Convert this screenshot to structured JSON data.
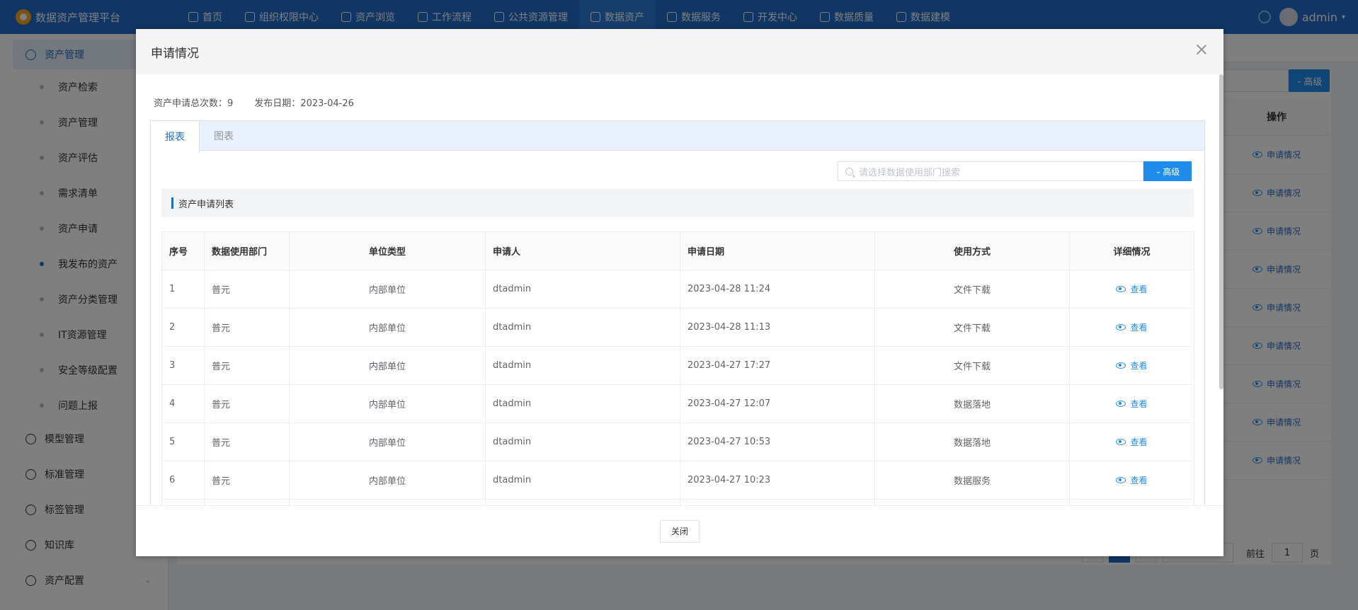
{
  "app": {
    "title": "数据资产管理平台"
  },
  "topnav": {
    "items": [
      {
        "label": "首页"
      },
      {
        "label": "组织权限中心"
      },
      {
        "label": "资产浏览"
      },
      {
        "label": "工作流程"
      },
      {
        "label": "公共资源管理"
      },
      {
        "label": "数据资产"
      },
      {
        "label": "数据服务"
      },
      {
        "label": "开发中心"
      },
      {
        "label": "数据质量"
      },
      {
        "label": "数据建模"
      }
    ],
    "active_index": 5,
    "user": "admin"
  },
  "sidebar": {
    "group_asset": "资产管理",
    "sub_items": [
      {
        "label": "资产检索"
      },
      {
        "label": "资产管理"
      },
      {
        "label": "资产评估"
      },
      {
        "label": "需求清单"
      },
      {
        "label": "资产申请"
      },
      {
        "label": "我发布的资产"
      },
      {
        "label": "资产分类管理"
      },
      {
        "label": "IT资源管理"
      },
      {
        "label": "安全等级配置"
      },
      {
        "label": "问题上报"
      }
    ],
    "active_sub": 5,
    "groups": [
      {
        "label": "模型管理"
      },
      {
        "label": "标准管理"
      },
      {
        "label": "标签管理"
      },
      {
        "label": "知识库"
      },
      {
        "label": "资产配置"
      }
    ]
  },
  "background": {
    "adv_label": "高级",
    "op_header": "操作",
    "op_link": "申请情况",
    "pager": {
      "goto_label": "前往",
      "page_value": "1",
      "page_suffix": "页"
    }
  },
  "dialog": {
    "title": "申请情况",
    "summary": {
      "total_label": "资产申请总次数：",
      "total_value": "9",
      "date_label": "发布日期：",
      "date_value": "2023-04-26"
    },
    "tabs": [
      {
        "label": "报表"
      },
      {
        "label": "图表"
      }
    ],
    "search_placeholder": "请选择数据使用部门搜索",
    "adv_label": "高级",
    "section_title": "资产申请列表",
    "columns": [
      "序号",
      "数据使用部门",
      "单位类型",
      "申请人",
      "申请日期",
      "使用方式",
      "详细情况"
    ],
    "rows": [
      {
        "no": "1",
        "dept": "普元",
        "unit": "内部单位",
        "applicant": "dtadmin",
        "date": "2023-04-28 11:24",
        "usage": "文件下载",
        "detail": "查看"
      },
      {
        "no": "2",
        "dept": "普元",
        "unit": "内部单位",
        "applicant": "dtadmin",
        "date": "2023-04-28 11:13",
        "usage": "文件下载",
        "detail": "查看"
      },
      {
        "no": "3",
        "dept": "普元",
        "unit": "内部单位",
        "applicant": "dtadmin",
        "date": "2023-04-27 17:27",
        "usage": "文件下载",
        "detail": "查看"
      },
      {
        "no": "4",
        "dept": "普元",
        "unit": "内部单位",
        "applicant": "dtadmin",
        "date": "2023-04-27 12:07",
        "usage": "数据落地",
        "detail": "查看"
      },
      {
        "no": "5",
        "dept": "普元",
        "unit": "内部单位",
        "applicant": "dtadmin",
        "date": "2023-04-27 10:53",
        "usage": "数据落地",
        "detail": "查看"
      },
      {
        "no": "6",
        "dept": "普元",
        "unit": "内部单位",
        "applicant": "dtadmin",
        "date": "2023-04-27 10:23",
        "usage": "数据服务",
        "detail": "查看"
      }
    ],
    "close_label": "关闭"
  }
}
